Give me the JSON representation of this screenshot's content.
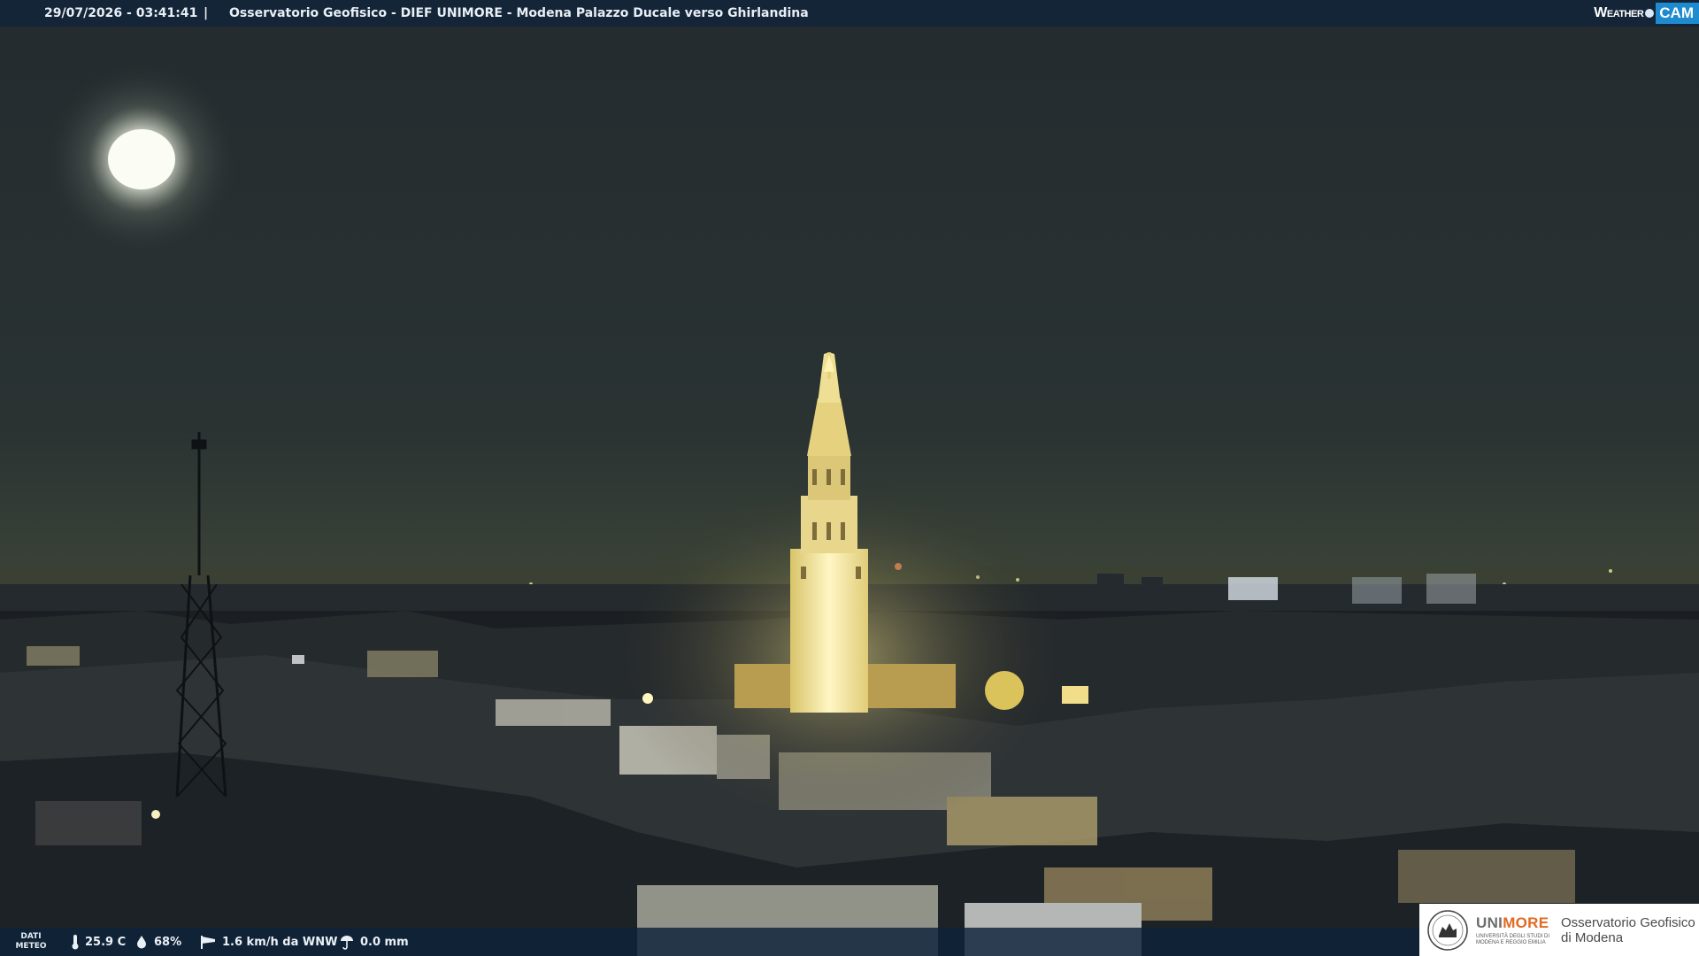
{
  "header": {
    "datetime": "29/07/2026 - 03:41:41",
    "separator": "|",
    "title": "Osservatorio Geofisico - DIEF UNIMORE - Modena Palazzo Ducale verso Ghirlandina"
  },
  "brand": {
    "weather_text": "Weather",
    "cam_text": "CAM",
    "accent_color": "#1e8bd0"
  },
  "weather_bar": {
    "dati_line1": "DATI",
    "dati_line2": "METEO",
    "temperature": "25.9 C",
    "humidity": "68%",
    "wind": "1.6 km/h da WNW",
    "rain": "0.0 mm",
    "icons": [
      "thermometer-icon",
      "humidity-drop-icon",
      "wind-sock-icon",
      "rain-gauge-icon"
    ]
  },
  "footer_logo": {
    "uni_part1": "UNI",
    "uni_part2": "MORE",
    "uni_subtitle": "UNIVERSITÀ DEGLI STUDI DI MODENA E REGGIO EMILIA",
    "observatory_line1": "Osservatorio Geofisico",
    "observatory_line2": "di Modena",
    "accent_color": "#e06a22"
  }
}
